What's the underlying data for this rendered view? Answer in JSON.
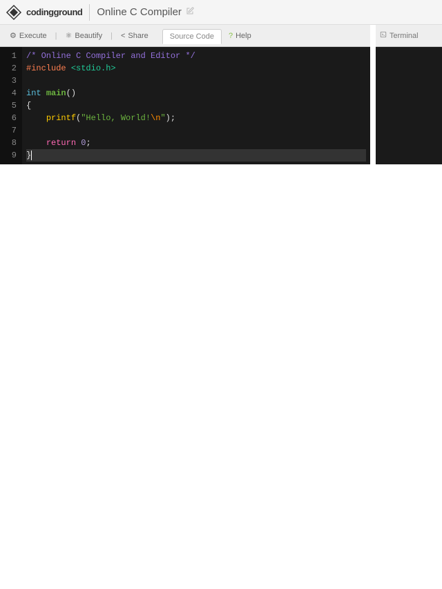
{
  "header": {
    "brand": "codingground",
    "title": "Online C Compiler"
  },
  "toolbar": {
    "execute": "Execute",
    "beautify": "Beautify",
    "share": "Share",
    "tab_source": "Source Code",
    "help": "Help"
  },
  "terminal": {
    "title": "Terminal"
  },
  "editor": {
    "active_line": 9,
    "lines": [
      {
        "n": 1,
        "tokens": [
          {
            "cls": "c-comment",
            "t": "/* Online C Compiler and Editor */"
          }
        ]
      },
      {
        "n": 2,
        "tokens": [
          {
            "cls": "c-preproc",
            "t": "#include"
          },
          {
            "cls": "",
            "t": " "
          },
          {
            "cls": "c-header",
            "t": "<stdio.h>"
          }
        ]
      },
      {
        "n": 3,
        "tokens": []
      },
      {
        "n": 4,
        "tokens": [
          {
            "cls": "c-type",
            "t": "int"
          },
          {
            "cls": "",
            "t": " "
          },
          {
            "cls": "c-func",
            "t": "main"
          },
          {
            "cls": "c-punc",
            "t": "()"
          }
        ]
      },
      {
        "n": 5,
        "tokens": [
          {
            "cls": "c-punc",
            "t": "{"
          }
        ]
      },
      {
        "n": 6,
        "tokens": [
          {
            "cls": "",
            "t": "    "
          },
          {
            "cls": "c-call",
            "t": "printf"
          },
          {
            "cls": "c-punc",
            "t": "("
          },
          {
            "cls": "c-str",
            "t": "\"Hello, World!"
          },
          {
            "cls": "c-esc",
            "t": "\\n"
          },
          {
            "cls": "c-str",
            "t": "\""
          },
          {
            "cls": "c-punc",
            "t": ");"
          }
        ]
      },
      {
        "n": 7,
        "tokens": []
      },
      {
        "n": 8,
        "tokens": [
          {
            "cls": "",
            "t": "    "
          },
          {
            "cls": "c-kw",
            "t": "return"
          },
          {
            "cls": "",
            "t": " "
          },
          {
            "cls": "c-num",
            "t": "0"
          },
          {
            "cls": "c-punc",
            "t": ";"
          }
        ]
      },
      {
        "n": 9,
        "tokens": [
          {
            "cls": "c-punc",
            "t": "}"
          }
        ]
      }
    ]
  }
}
